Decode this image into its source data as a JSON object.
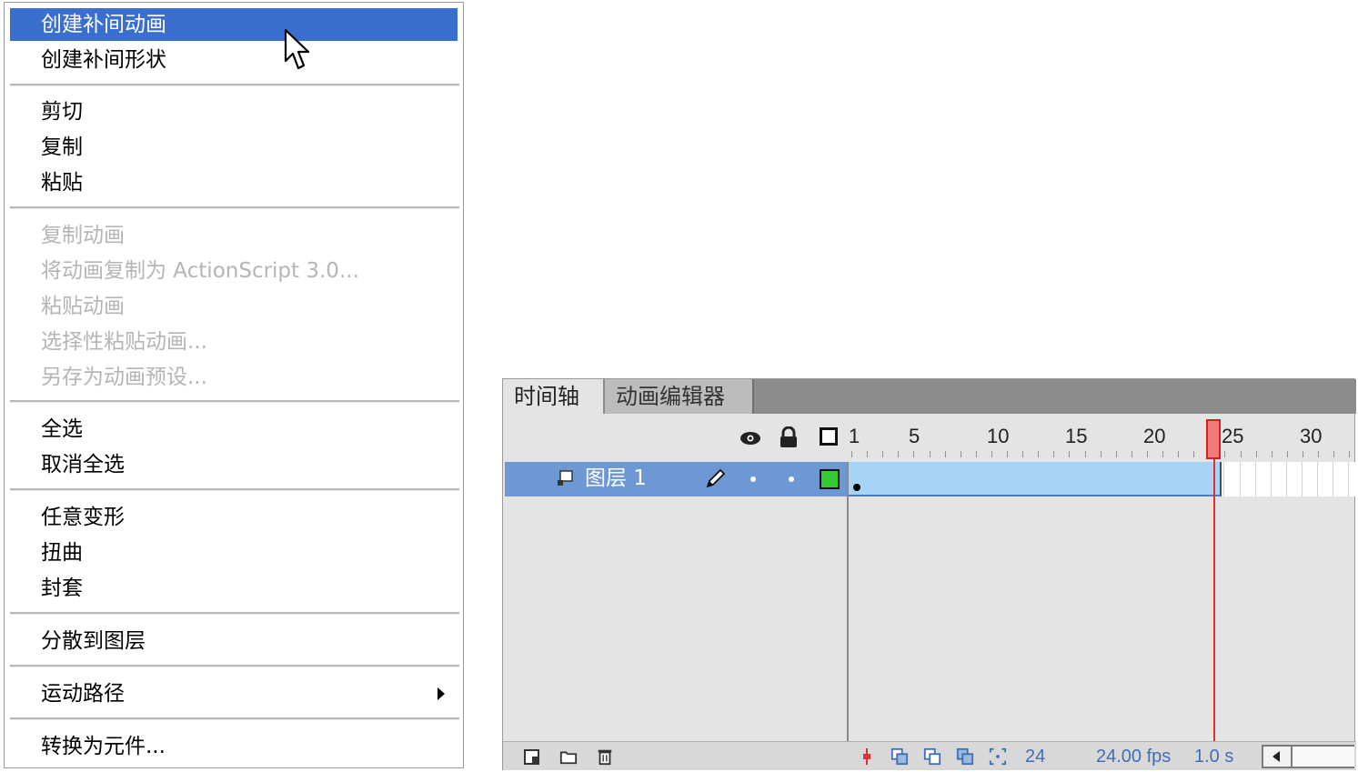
{
  "context_menu": {
    "items": [
      {
        "label": "创建补间动画",
        "state": "highlighted"
      },
      {
        "label": "创建补间形状",
        "state": "normal"
      },
      {
        "label": "剪切",
        "state": "normal"
      },
      {
        "label": "复制",
        "state": "normal"
      },
      {
        "label": "粘贴",
        "state": "normal"
      },
      {
        "label": "复制动画",
        "state": "disabled"
      },
      {
        "label": "将动画复制为 ActionScript 3.0...",
        "state": "disabled"
      },
      {
        "label": "粘贴动画",
        "state": "disabled"
      },
      {
        "label": "选择性粘贴动画...",
        "state": "disabled"
      },
      {
        "label": "另存为动画预设...",
        "state": "disabled"
      },
      {
        "label": "全选",
        "state": "normal"
      },
      {
        "label": "取消全选",
        "state": "normal"
      },
      {
        "label": "任意变形",
        "state": "normal"
      },
      {
        "label": "扭曲",
        "state": "normal"
      },
      {
        "label": "封套",
        "state": "normal"
      },
      {
        "label": "分散到图层",
        "state": "normal"
      },
      {
        "label": "运动路径",
        "state": "normal",
        "has_submenu": true
      },
      {
        "label": "转换为元件...",
        "state": "normal"
      }
    ]
  },
  "timeline": {
    "tabs": [
      "时间轴",
      "动画编辑器"
    ],
    "active_tab": "时间轴",
    "header_icons": [
      "eye-icon",
      "lock-icon",
      "outline-icon"
    ],
    "ruler_labels": [
      "1",
      "5",
      "10",
      "15",
      "20",
      "25",
      "30"
    ],
    "layer": {
      "name": "图层 1",
      "color": "#33cc33",
      "tween_start_frame": 1,
      "tween_end_frame": 24
    },
    "playhead_frame": 24,
    "status": {
      "current_frame": "24",
      "frame_rate": "24.00 fps",
      "elapsed_time": "1.0 s"
    }
  },
  "colors": {
    "menu_highlight": "#3a6fcf",
    "layer_selected": "#6e98d3",
    "tween_span": "#a7d3f6",
    "playhead": "#e03030",
    "status_text": "#3f6fb5"
  }
}
